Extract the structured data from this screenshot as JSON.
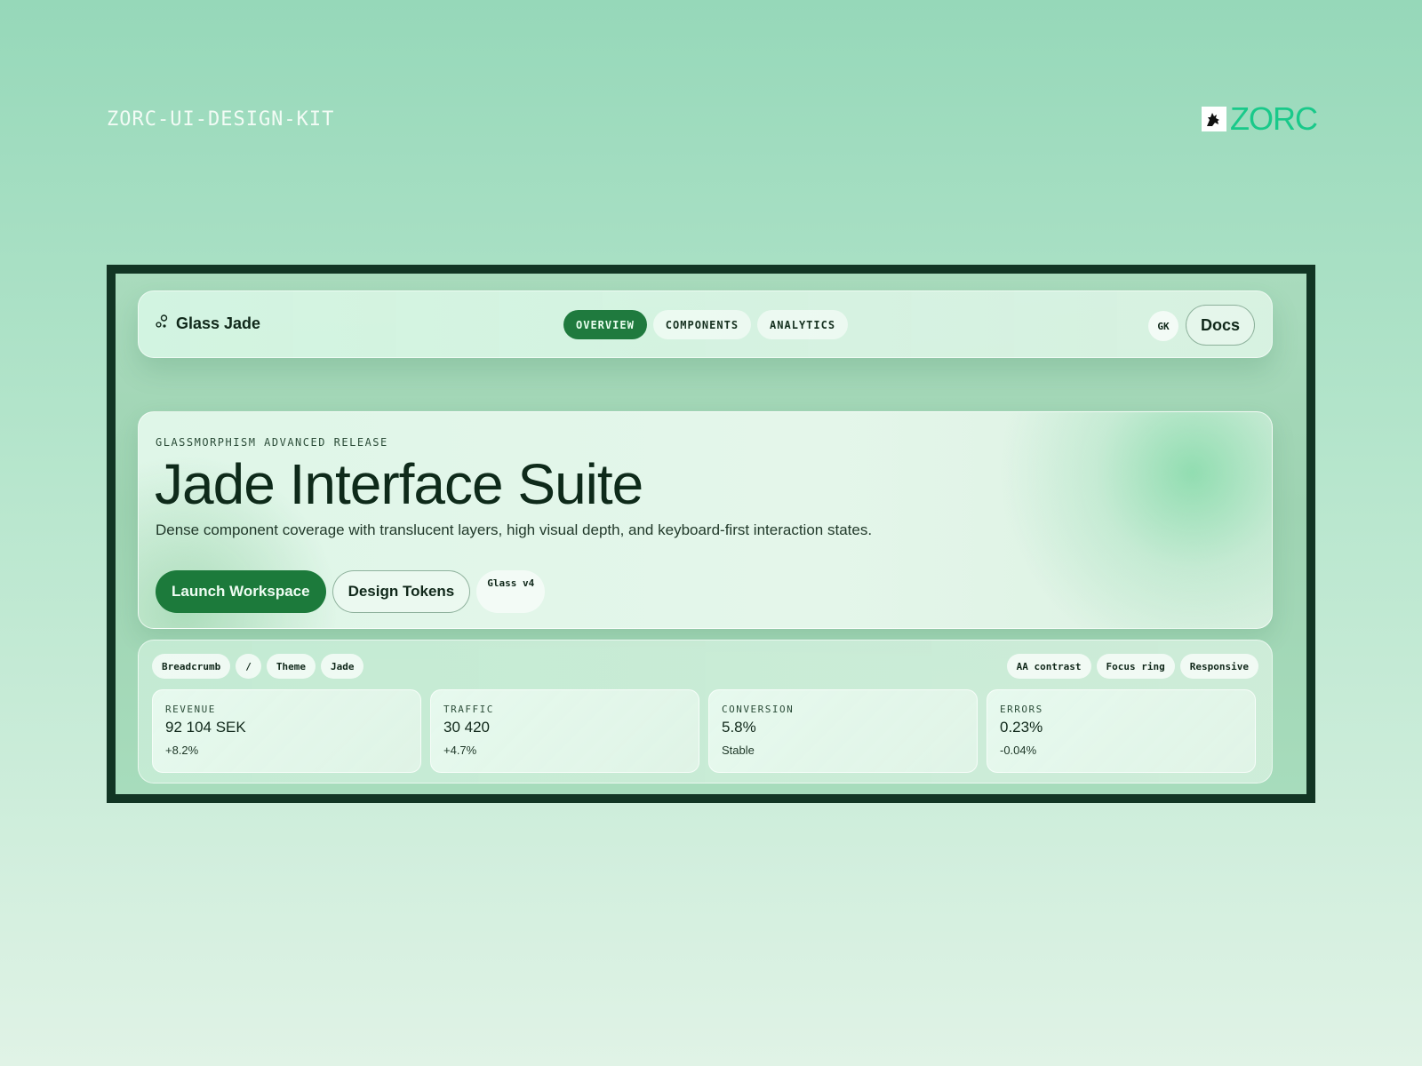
{
  "page": {
    "kit_title": "ZORC-UI-DESIGN-KIT",
    "brand_word": "ZORC",
    "brand_color": "#19c98a"
  },
  "nav": {
    "brand_icon": "nodes-icon",
    "brand_label": "Glass Jade",
    "tabs": [
      {
        "label": "OVERVIEW",
        "active": true
      },
      {
        "label": "COMPONENTS",
        "active": false
      },
      {
        "label": "ANALYTICS",
        "active": false
      }
    ],
    "avatar_initials": "GK",
    "docs_label": "Docs"
  },
  "hero": {
    "eyebrow": "GLASSMORPHISM ADVANCED RELEASE",
    "title": "Jade Interface Suite",
    "description": "Dense component coverage with translucent layers, high visual depth, and keyboard-first interaction states.",
    "primary_label": "Launch Workspace",
    "secondary_label": "Design Tokens",
    "version_chip": "Glass v4"
  },
  "metrics": {
    "breadcrumb": [
      "Breadcrumb",
      "/",
      "Theme",
      "Jade"
    ],
    "flags": [
      "AA contrast",
      "Focus ring",
      "Responsive"
    ],
    "cards": [
      {
        "label": "REVENUE",
        "value": "92 104 SEK",
        "delta": "+8.2%"
      },
      {
        "label": "TRAFFIC",
        "value": "30 420",
        "delta": "+4.7%"
      },
      {
        "label": "CONVERSION",
        "value": "5.8%",
        "delta": "Stable"
      },
      {
        "label": "ERRORS",
        "value": "0.23%",
        "delta": "-0.04%"
      }
    ]
  },
  "colors": {
    "accent": "#1c7a3b",
    "frame": "#123524"
  }
}
